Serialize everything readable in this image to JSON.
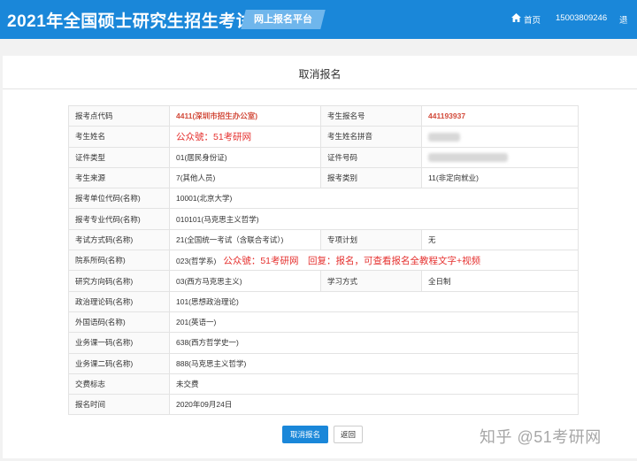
{
  "header": {
    "site_title": "2021年全国硕士研究生招生考试",
    "platform_label": "网上报名平台",
    "home_label": "首页",
    "phone": "15003809246",
    "exit_label": "退"
  },
  "page": {
    "title": "取消报名"
  },
  "rows": [
    {
      "l1": "报考点代码",
      "v1": "4411(深圳市招生办公室)",
      "l2": "考生报名号",
      "v2": "441193937"
    },
    {
      "l1": "考生姓名",
      "v1": "",
      "l2": "考生姓名拼音",
      "v2": ""
    },
    {
      "l1": "证件类型",
      "v1": "01(居民身份证)",
      "l2": "证件号码",
      "v2": ""
    },
    {
      "l1": "考生来源",
      "v1": "7(其他人员)",
      "l2": "报考类别",
      "v2": "11(非定向就业)"
    },
    {
      "l1": "报考单位代码(名称)",
      "v1": "10001(北京大学)"
    },
    {
      "l1": "报考专业代码(名称)",
      "v1": "010101(马克思主义哲学)"
    },
    {
      "l1": "考试方式码(名称)",
      "v1": "21(全国统一考试（含联合考试）)",
      "l2": "专项计划",
      "v2": "无"
    },
    {
      "l1": "院系所码(名称)",
      "v1": "023(哲学系)"
    },
    {
      "l1": "研究方向码(名称)",
      "v1": "03(西方马克思主义)",
      "l2": "学习方式",
      "v2": "全日制"
    },
    {
      "l1": "政治理论码(名称)",
      "v1": "101(思想政治理论)"
    },
    {
      "l1": "外国语码(名称)",
      "v1": "201(英语一)"
    },
    {
      "l1": "业务课一码(名称)",
      "v1": "638(西方哲学史一)"
    },
    {
      "l1": "业务课二码(名称)",
      "v1": "888(马克思主义哲学)"
    },
    {
      "l1": "交费标志",
      "v1": "未交费"
    },
    {
      "l1": "报名时间",
      "v1": "2020年09月24日"
    }
  ],
  "overlays": {
    "name_watermark": "公众號：51考研网",
    "dept_watermark": "公众號：51考研网　回复：报名，可查看报名全教程文字+视频",
    "corner_watermark": "知乎 @51考研网"
  },
  "buttons": {
    "cancel_registration": "取消报名",
    "back": "返回"
  },
  "colors": {
    "header_bg": "#1a87d9",
    "accent_red": "#d24a3a",
    "watermark_red": "#e5312f"
  }
}
